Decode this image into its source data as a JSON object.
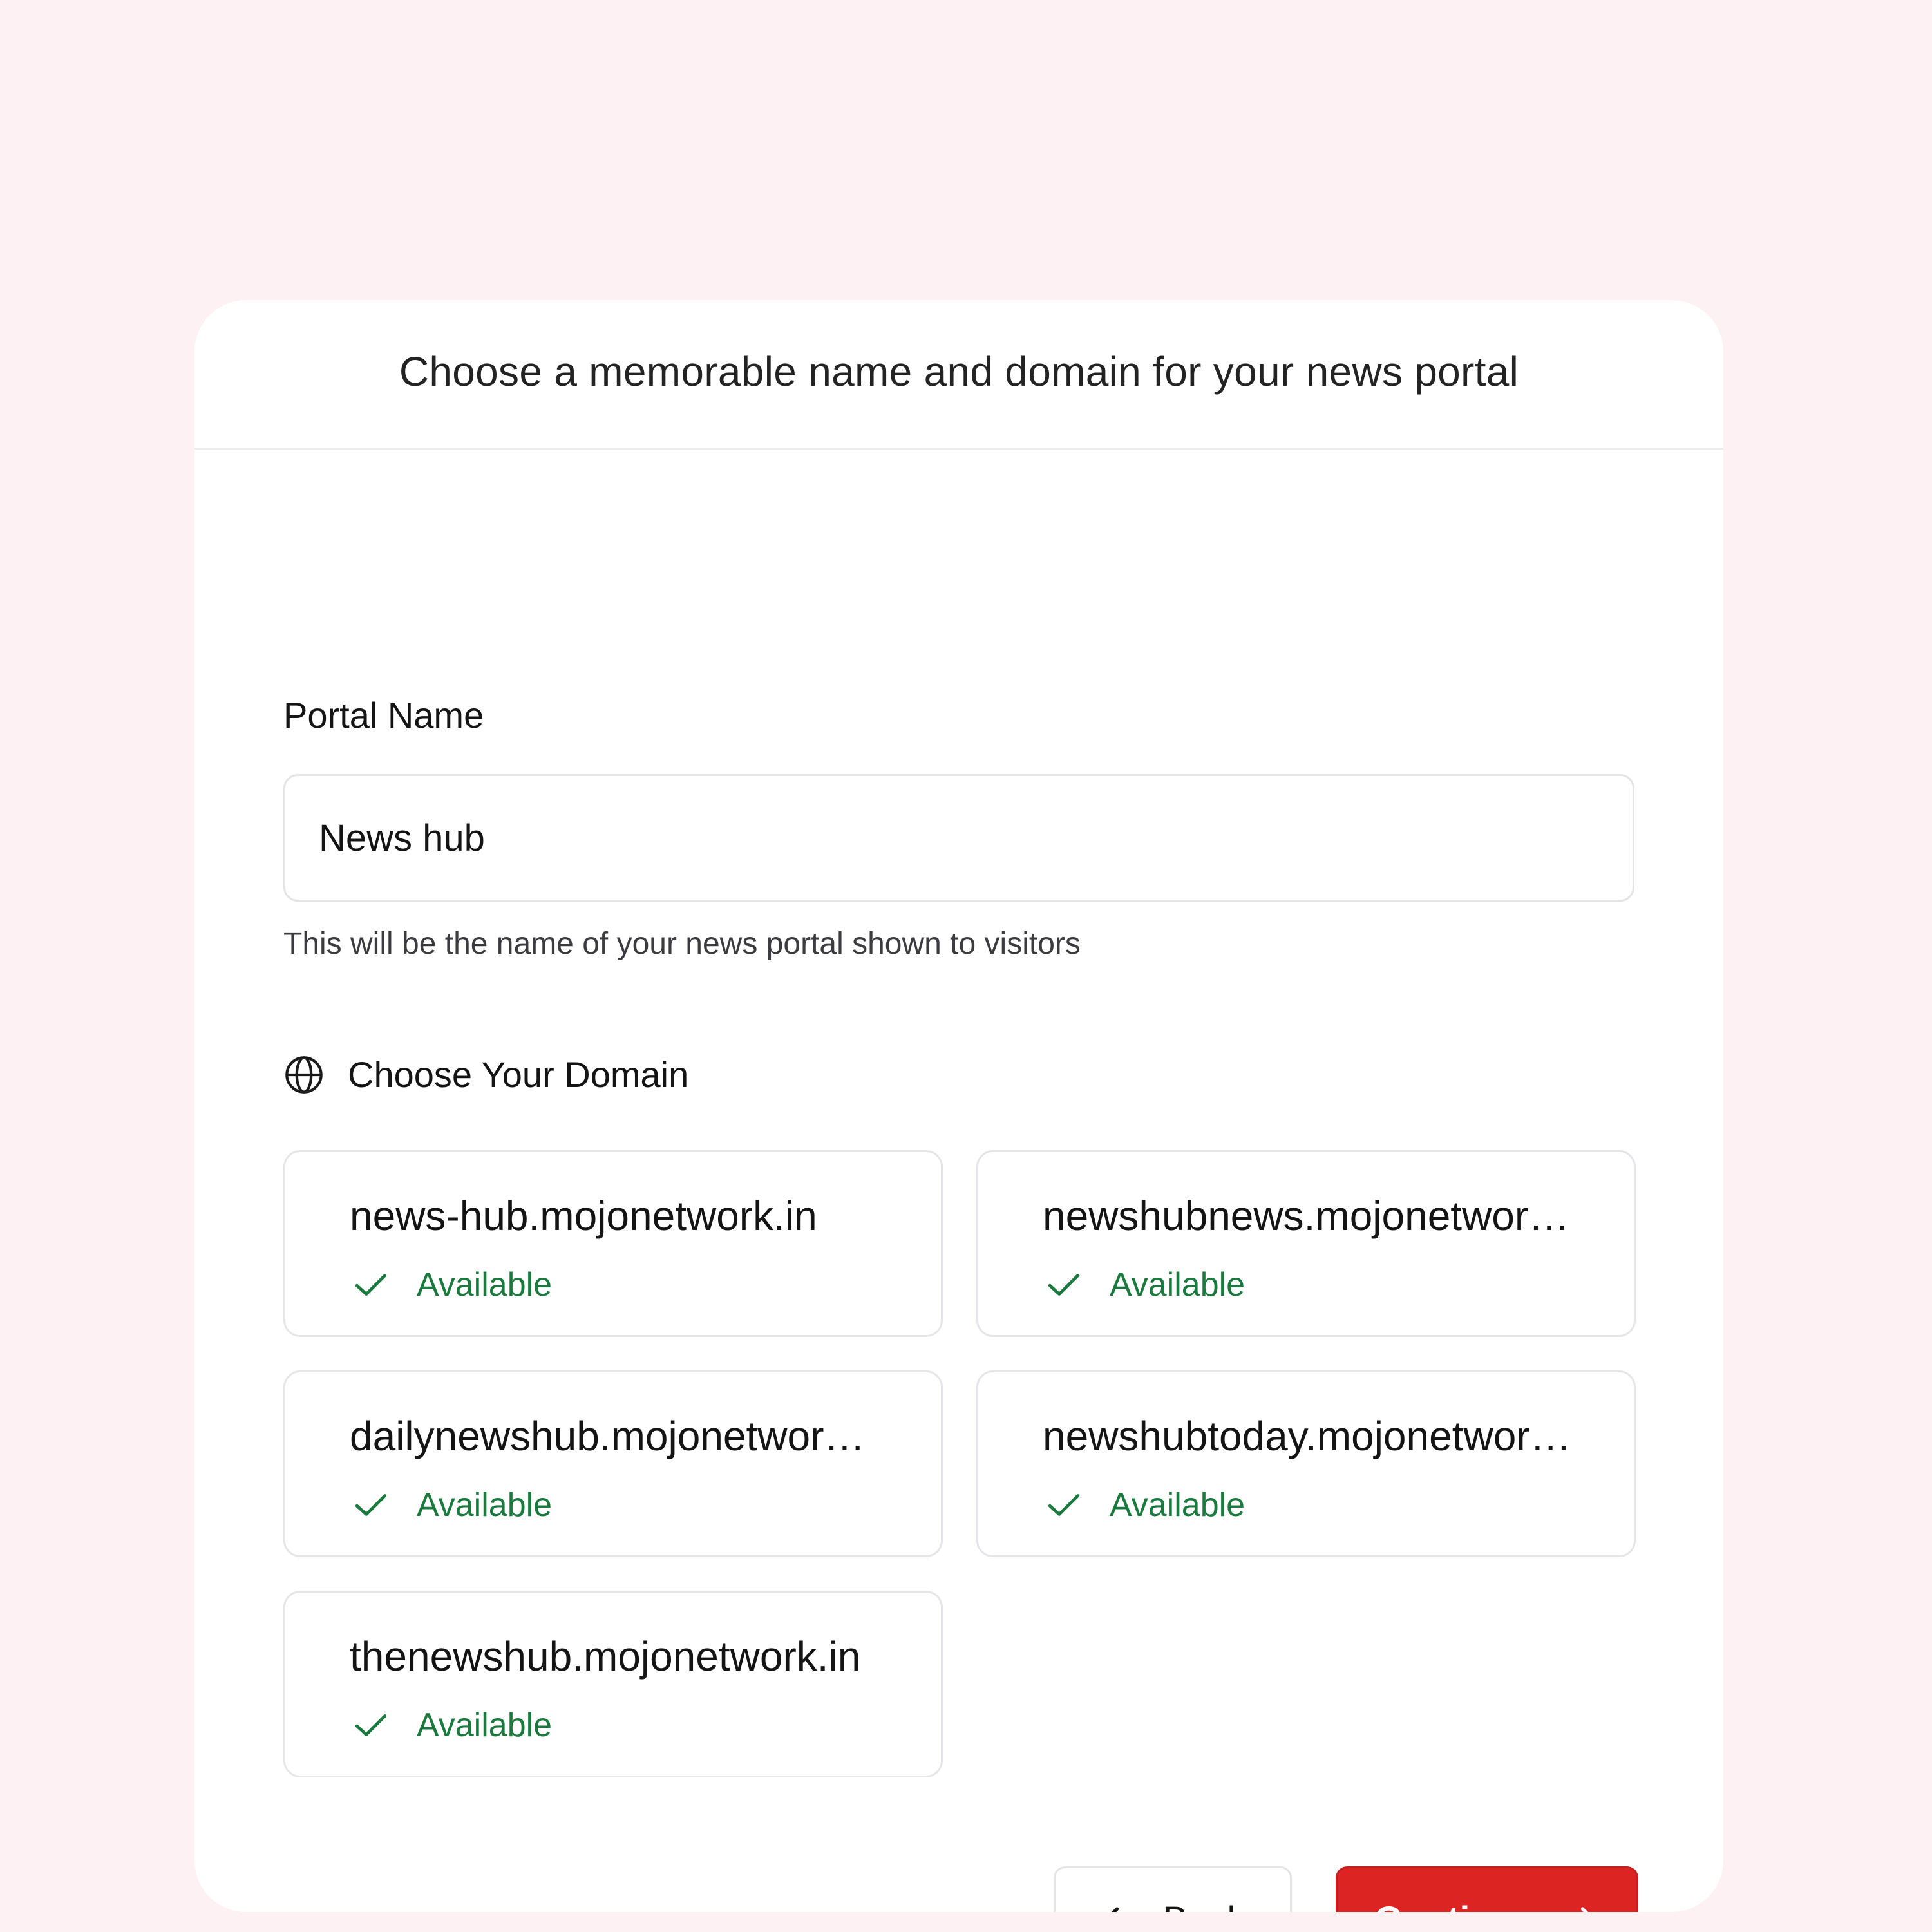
{
  "header": {
    "title": "Choose a memorable name and domain for your news portal"
  },
  "portal_name": {
    "label": "Portal Name",
    "value": "News hub",
    "helper": "This will be the name of your news portal shown to visitors"
  },
  "domains": {
    "heading": "Choose Your Domain",
    "heading_icon": "globe-icon",
    "status_icon": "check-icon",
    "items": [
      {
        "name": "news-hub.mojonetwork.in",
        "status": "Available"
      },
      {
        "name": "newshubnews.mojonetwor…",
        "status": "Available"
      },
      {
        "name": "dailynewshub.mojonetwor…",
        "status": "Available"
      },
      {
        "name": "newshubtoday.mojonetwor…",
        "status": "Available"
      },
      {
        "name": "thenewshub.mojonetwork.in",
        "status": "Available"
      }
    ]
  },
  "actions": {
    "back_label": "Back",
    "continue_label": "Continue"
  },
  "colors": {
    "background": "#fdf1f4",
    "accent": "#dc2423",
    "available": "#1a7a3e"
  }
}
